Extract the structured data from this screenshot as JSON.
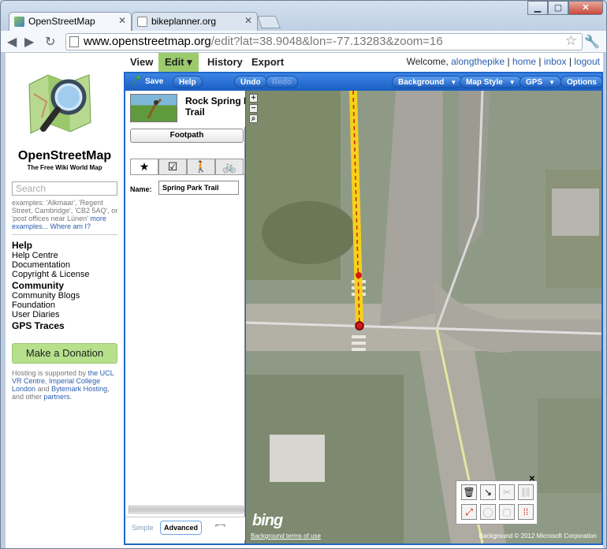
{
  "browser": {
    "tabs": [
      {
        "title": "OpenStreetMap",
        "active": true
      },
      {
        "title": "bikeplanner.org",
        "active": false
      }
    ],
    "url_host": "www.openstreetmap.org",
    "url_path": "/edit?lat=38.9048&lon=-77.13283&zoom=16"
  },
  "sidebar": {
    "brand": "OpenStreetMap",
    "tagline": "The Free Wiki World Map",
    "search_placeholder": "Search",
    "examples_text": "examples: 'Alkmaar', 'Regent Street, Cambridge', 'CB2 5AQ', or 'post offices near Lünen'",
    "more_examples": "more examples...",
    "where_am_i": "Where am I?",
    "help_header": "Help",
    "help_links": [
      "Help Centre",
      "Documentation",
      "Copyright & License"
    ],
    "community_header": "Community",
    "community_links": [
      "Community Blogs",
      "Foundation",
      "User Diaries"
    ],
    "gps_traces": "GPS Traces",
    "donate": "Make a Donation",
    "hosting_prefix": "Hosting is supported by",
    "hosting_link1": "the UCL VR Centre",
    "hosting_link2": "Imperial College London",
    "hosting_and": "and",
    "hosting_link3": "Bytemark Hosting",
    "hosting_suffix": ", and other",
    "hosting_partners": "partners"
  },
  "topnav": {
    "view": "View",
    "edit": "Edit ▾",
    "history": "History",
    "export": "Export",
    "welcome": "Welcome,",
    "user": "alongthepike",
    "home": "home",
    "inbox": "inbox",
    "logout": "logout"
  },
  "potlatch": {
    "save": "Save",
    "help": "Help",
    "undo": "Undo",
    "redo": "Redo",
    "background": "Background",
    "map_style": "Map Style",
    "gps": "GPS",
    "options": "Options"
  },
  "inspector": {
    "title_line1": "Rock Spring P",
    "title_line2": "Trail",
    "type": "Footpath",
    "tabs": [
      "★",
      "☑",
      "🚶",
      "🚲"
    ],
    "name_label": "Name:",
    "name_value": "Spring Park Trail",
    "mode_simple": "Simple",
    "mode_advanced": "Advanced",
    "mode_tool": "⌐¬"
  },
  "map": {
    "bing_label": "bing",
    "terms": "Background terms of use",
    "copyright": "Background © 2012 Microsoft Corporation",
    "zoom_in": "+",
    "zoom_out": "−",
    "zoom_search": "⌕"
  },
  "colors": {
    "osm_green": "#9ccb6d",
    "potlatch_blue": "#1f66c8",
    "path_yellow": "#f5d21a",
    "node_red": "#d11a1a",
    "link_blue": "#2a5db0"
  }
}
